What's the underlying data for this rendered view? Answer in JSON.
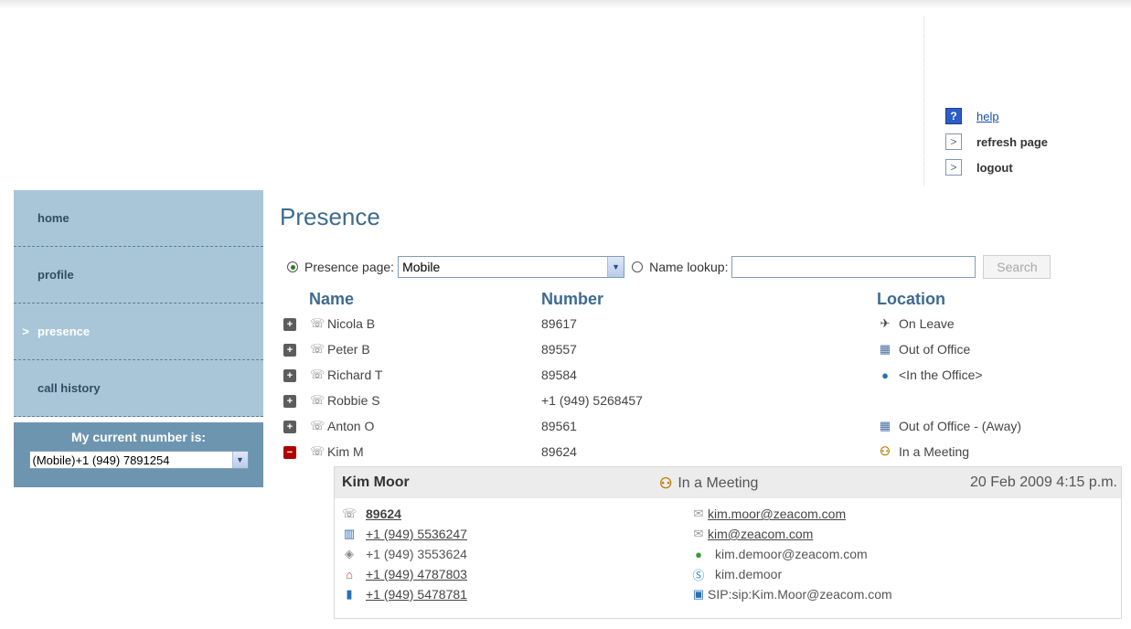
{
  "toplinks": {
    "help": "help",
    "refresh": "refresh page",
    "logout": "logout"
  },
  "sidebar": {
    "items": [
      {
        "label": "home"
      },
      {
        "label": "profile"
      },
      {
        "label": "presence"
      },
      {
        "label": "call history"
      }
    ],
    "current_number_title": "My current number is:",
    "current_number_value": "(Mobile)+1 (949) 7891254"
  },
  "main": {
    "title": "Presence",
    "presence_page_label": "Presence page:",
    "presence_page_value": "Mobile",
    "name_lookup_label": "Name lookup:",
    "name_lookup_value": "",
    "search_label": "Search"
  },
  "table": {
    "headers": {
      "name": "Name",
      "number": "Number",
      "location": "Location"
    },
    "rows": [
      {
        "name": "Nicola B",
        "number": "89617",
        "location": "On Leave",
        "location_icon": "plane-icon"
      },
      {
        "name": "Peter B",
        "number": "89557",
        "location": "Out of Office",
        "location_icon": "building-icon"
      },
      {
        "name": "Richard T",
        "number": "89584",
        "location": "<In the Office>",
        "location_icon": "person-icon"
      },
      {
        "name": "Robbie S",
        "number": "+1 (949) 5268457",
        "location": "",
        "location_icon": ""
      },
      {
        "name": "Anton O",
        "number": "89561",
        "location": "Out of Office - (Away)",
        "location_icon": "building-icon"
      },
      {
        "name": "Kim M",
        "number": "89624",
        "location": "In a Meeting",
        "location_icon": "meeting-icon"
      }
    ]
  },
  "detail": {
    "name": "Kim Moor",
    "status": "In a Meeting",
    "datetime": "20 Feb 2009 4:15 p.m.",
    "phones": [
      {
        "icon": "desk-phone-icon",
        "value": "89624"
      },
      {
        "icon": "office-building-icon",
        "value": "+1 (949) 5536247"
      },
      {
        "icon": "fax-icon",
        "value": "+1 (949) 3553624"
      },
      {
        "icon": "home-icon",
        "value": "+1 (949) 4787803"
      },
      {
        "icon": "mobile-phone-icon",
        "value": "+1 (949) 5478781"
      }
    ],
    "contacts": [
      {
        "icon": "email-icon",
        "value": "kim.moor@zeacom.com"
      },
      {
        "icon": "email-icon",
        "value": "kim@zeacom.com"
      },
      {
        "icon": "im-user-icon",
        "value": "kim.demoor@zeacom.com"
      },
      {
        "icon": "skype-icon",
        "value": "kim.demoor"
      },
      {
        "icon": "sip-icon",
        "value": "SIP:sip:Kim.Moor@zeacom.com"
      }
    ]
  },
  "colors": {
    "sidebar_bg": "#a9c6d8",
    "sidebar_accent": "#6d95b0",
    "heading_blue": "#3e6b8f"
  }
}
